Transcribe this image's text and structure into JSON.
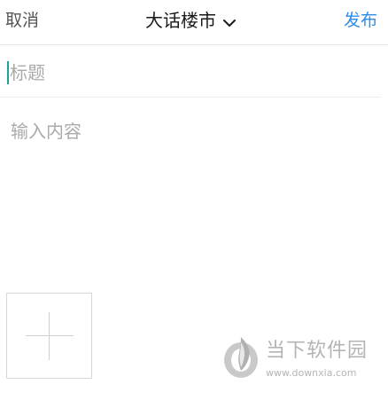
{
  "header": {
    "cancel_label": "取消",
    "title": "大话楼市",
    "publish_label": "发布",
    "publish_color": "#2f8ce6"
  },
  "title_field": {
    "placeholder": "标题",
    "value": ""
  },
  "content_field": {
    "placeholder": "输入内容",
    "value": ""
  },
  "add_image": {
    "icon": "plus-icon"
  },
  "watermark": {
    "name": "当下软件园",
    "url": "www.downxia.com"
  }
}
